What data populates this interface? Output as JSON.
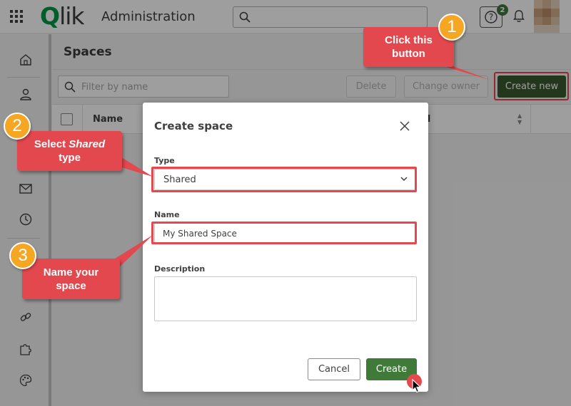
{
  "header": {
    "logo_letter": "Q",
    "logo_rest": "lik",
    "title": "Administration",
    "help_badge_count": "2"
  },
  "main": {
    "page_title": "Spaces",
    "filter_placeholder": "Filter by name",
    "buttons": {
      "delete": "Delete",
      "change_owner": "Change owner",
      "create_new": "Create new"
    },
    "table_headers": [
      "Name",
      "d"
    ]
  },
  "dialog": {
    "title": "Create space",
    "type_label": "Type",
    "type_value": "Shared",
    "name_label": "Name",
    "name_value": "My Shared Space",
    "description_label": "Description",
    "description_value": "",
    "cancel_label": "Cancel",
    "create_label": "Create"
  },
  "callouts": [
    {
      "number": "1",
      "text": "Click this button"
    },
    {
      "number": "2",
      "text_prefix": "Select ",
      "text_emph": "Shared",
      "text_suffix": " type"
    },
    {
      "number": "3",
      "text": "Name your space"
    }
  ],
  "colors": {
    "accent_green": "#3f7a39",
    "annotation_red": "#e2484d",
    "badge_orange": "#f5a623"
  },
  "sidebar_icons": [
    "home-icon",
    "user-icon",
    "mail-icon",
    "clock-icon",
    "link-icon",
    "puzzle-icon",
    "palette-icon"
  ]
}
